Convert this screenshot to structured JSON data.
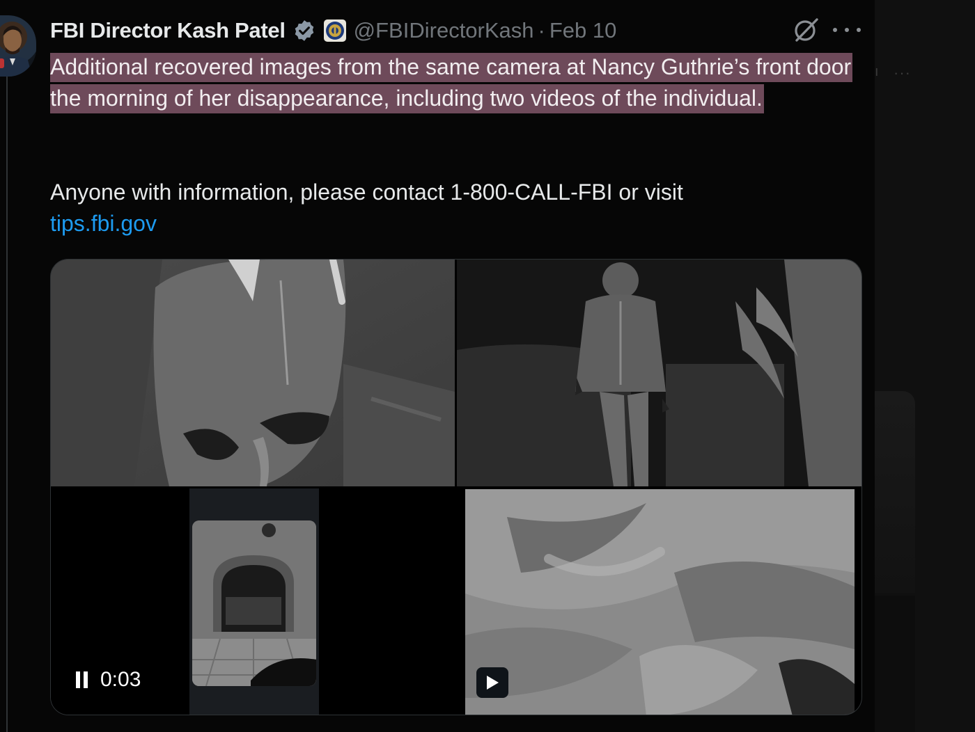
{
  "tweet": {
    "author_name": "FBI Director Kash Patel",
    "handle": "@FBIDirectorKash",
    "separator": "·",
    "date": "Feb 10",
    "highlighted_text": "Additional recovered images from the same camera at Nancy Guthrie’s front door the morning of her disappearance, including two videos of the individual.",
    "body_text": "Anyone with information, please contact 1-800-CALL-FBI or visit",
    "link_text": "tips.fbi.gov",
    "highlight_color": "#6e4a5a",
    "link_color": "#1d9bf0"
  },
  "icons": {
    "verified": "verified-badge-icon",
    "affiliation": "fbi-seal-icon",
    "grok": "grok-icon",
    "more": "more-options-icon",
    "pause": "pause-icon",
    "play": "play-icon"
  },
  "media": {
    "video_timestamp": "0:03"
  }
}
